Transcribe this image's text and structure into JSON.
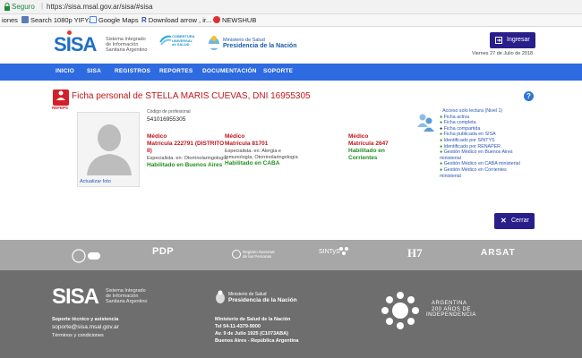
{
  "browser": {
    "secure_label": "Seguro",
    "url": "https://sisa.msal.gov.ar/sisa/#sisa",
    "bookmarks": [
      "iones",
      "Search 1080p YIFY...",
      "Google Maps",
      "Download arrow , ir...",
      "NEWSHUB"
    ]
  },
  "header": {
    "logo_text": "SISA",
    "logo_sub": [
      "Sistema Integrado",
      "de Información",
      "Sanitaria Argentino"
    ],
    "cobertura": [
      "COBERTURA",
      "UNIVERSAL",
      "de SALUD"
    ],
    "ministerio_line1": "Ministerio de Salud",
    "ministerio_line2": "Presidencia de la Nación",
    "login_button": "Ingresar",
    "date": "Viernes 27 de Julio de 2018"
  },
  "nav": {
    "items": [
      "INICIO",
      "SISA",
      "REGISTROS",
      "REPORTES",
      "DOCUMENTACIÓN",
      "SOPORTE"
    ]
  },
  "profile": {
    "refeps_label": "REFEPS",
    "title": "Ficha personal de STELLA MARIS CUEVAS, DNI 16955305",
    "code_label": "Código de profesional",
    "code_value": "541016955305",
    "photo_label": "Actualizar foto",
    "columns": [
      {
        "role": "Médico",
        "matricula": "Matrícula 222791 (DISTRITO II)",
        "specialty": "Especialista. en: Otorrinolaringología",
        "status": "Habilitado en Buenos Aires"
      },
      {
        "role": "Médico",
        "matricula": "Matrícula 81701",
        "specialty": "Especialista. en: Alergia e Inmunología, Otorrinolaringología",
        "status": "Habilitado en CABA"
      },
      {
        "role": "Médico",
        "matricula": "Matrícula 2647",
        "specialty": "",
        "status": "Habilitado en Corrientes"
      }
    ],
    "side_links": [
      "Acceso solo lectura (Nivel 1)",
      "Ficha activa",
      "Ficha completa",
      "Ficha compartida",
      "Ficha publicada en SISA",
      "Identificado por SINTYS",
      "Identificado por RENAPER",
      "Gestión Médico en Buenos Aires ministerial",
      "Gestión Médico en CABA ministerial",
      "Gestión Médico en Corrientes ministerial"
    ],
    "close_button": "Cerrar",
    "help_icon_label": "?"
  },
  "footer_logos": {
    "pdp": "PDP",
    "registro": [
      "Registro Nacional",
      "de las Personas"
    ],
    "sintys": "SINTyS",
    "h7": "H7",
    "arsat": "ARSAT"
  },
  "footer": {
    "logo_text": "SISA",
    "logo_sub": [
      "Sistema Integrado",
      "de Información",
      "Sanitaria Argentino"
    ],
    "support_title": "Soporte técnico y asistencia",
    "support_email": "soporte@sisa.msal.gov.ar",
    "terms": "Términos y condiciones",
    "ministerio_line1": "Ministerio de Salud",
    "ministerio_line2": "Presidencia de la Nación",
    "address_title": "Ministerio de Salud de la Nación",
    "phone": "Tel 54-11-4379-9000",
    "address": "Av. 9 de Julio 1925 (C1073ABA)",
    "city": "Buenos Aires - República Argentina",
    "bicentenario_1": "ARGENTINA",
    "bicentenario_2": "200 AÑOS DE",
    "bicentenario_3": "INDEPENDENCIA"
  }
}
